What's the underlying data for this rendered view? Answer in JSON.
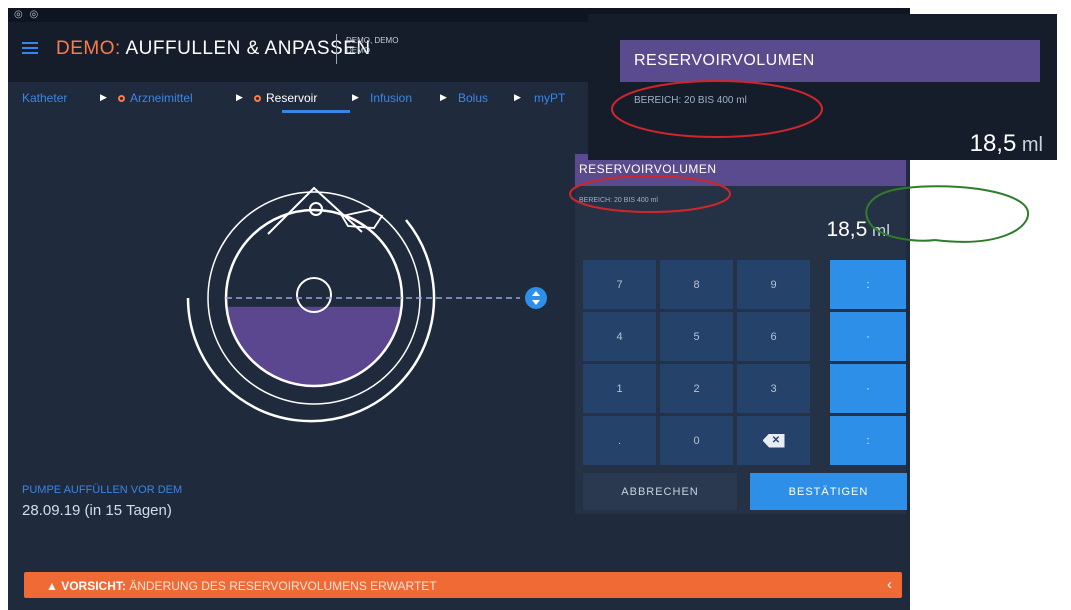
{
  "status": {
    "icons": "◎ ◎"
  },
  "header": {
    "title_demo": "DEMO:",
    "title_main": " AUFFULLEN & ANPASSEN",
    "user_line1": "DEMO, DEMO",
    "user_line2": "DEMO"
  },
  "nav": {
    "items": [
      "Katheter",
      "Arzneimittel",
      "Reservoir",
      "Infusion",
      "Bolus",
      "myPT"
    ],
    "active_index": 2
  },
  "refill": {
    "label": "PUMPE AUFFÜLLEN VOR DEM",
    "date": "28.09.19 (in 15 Tagen)"
  },
  "warning": {
    "prefix": "VORSICHT:",
    "text": " ÄNDERUNG DES RESERVOIRVOLUMENS ERWARTET",
    "chevron": "‹"
  },
  "keypad_panel": {
    "title": "RESERVOIRVOLUMEN",
    "range": "BEREICH: 20 BIS 400 ml",
    "value": "18,5",
    "unit": " ml",
    "keys": [
      [
        "7",
        "8",
        "9",
        ":"
      ],
      [
        "4",
        "5",
        "6",
        "·"
      ],
      [
        "1",
        "2",
        "3",
        "·"
      ],
      [
        ".",
        "0",
        "⌫",
        ":"
      ]
    ],
    "cancel_label": "ABBRECHEN",
    "confirm_label": "BESTÄTIGEN"
  },
  "zoom_panel": {
    "title": "RESERVOIRVOLUMEN",
    "range": "BEREICH: 20 BIS 400 ml",
    "value": "18,5",
    "unit": " ml"
  },
  "reservoir_fill_level": 0.45,
  "colors": {
    "accent_blue": "#2d8fe8",
    "header_purple": "#5a4a8e",
    "warning_orange": "#f06a36",
    "annotation_red": "#d0262b",
    "annotation_green": "#2f7d2a"
  }
}
